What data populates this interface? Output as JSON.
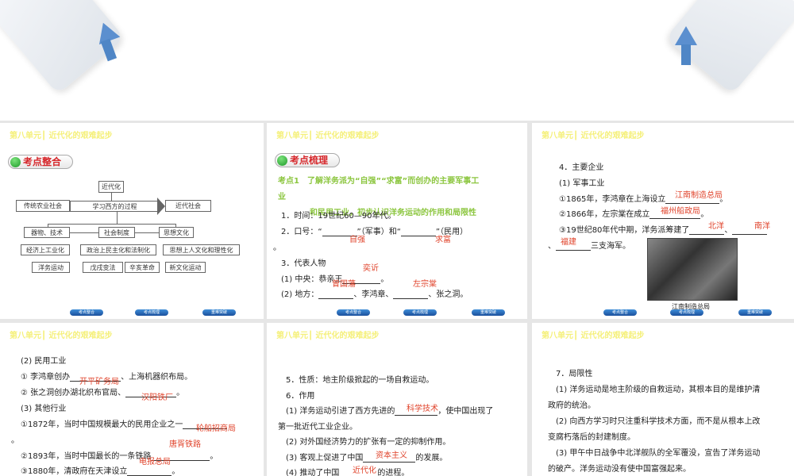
{
  "unit_header": "第八单元┃ 近代化的艰难起步",
  "nav": [
    "考点整合",
    "考点梳理",
    "重难突破"
  ],
  "slide1": {
    "badge": "考点整合",
    "diagram": {
      "top": "近代化",
      "left": "传统农业社会",
      "arrow": "学习西方的过程",
      "right": "近代社会",
      "c1": "器物、技术",
      "c2": "社会制度",
      "c3": "思想文化",
      "d1": "经济上工业化",
      "d2": "政治上民主化和法制化",
      "d3": "思想上人文化和理性化",
      "e1": "洋务运动",
      "e2": "戊戌变法",
      "e3": "辛亥革命",
      "e4": "新文化运动"
    }
  },
  "slide2": {
    "badge": "考点梳理",
    "point": "考点1　了解洋务派为“自强”“求富”而创办的主要军事工",
    "point2": "业",
    "overlay": "和民用工业，初步认识洋务运动的作用和局限性",
    "l1": "1．时间：19世纪60—90年代。",
    "l2a": "2．口号：“",
    "l2b": "”（军事）和“",
    "l2c": "”（民用）",
    "l3": "。",
    "l4": "3．代表人物",
    "l5a": "(1) 中央：恭亲王",
    "l5b": "。",
    "l6a": "(2) 地方：",
    "l6b": "、李鸿章、",
    "l6c": "、张之洞。",
    "answers": {
      "a1": "自强",
      "a2": "求富",
      "a3": "奕䜣",
      "a4": "曾国藩",
      "a5": "左宗棠"
    }
  },
  "slide3": {
    "l1": "4．主要企业",
    "l2": "(1) 军事工业",
    "l3a": "①1865年，李鸿章在上海设立",
    "l3b": "。",
    "l4a": "②1866年，左宗棠在成立",
    "l4b": "。",
    "l5a": "③19世纪80年代中期，洋务派筹建了",
    "l5b": "、",
    "l6a": "、",
    "l6b": "三支海军。",
    "caption": "江南制造总局",
    "answers": {
      "a1": "江南制造总局",
      "a2": "福州船政局",
      "a3": "北洋",
      "a4": "南洋",
      "a5": "福建"
    }
  },
  "slide4": {
    "l1": "(2) 民用工业",
    "l2a": "① 李鸿章创办",
    "l2b": "、上海机器织布局。",
    "l3a": "② 张之洞创办湖北织布官局、",
    "l3b": "。",
    "l4": "(3) 其他行业",
    "l5": "①1872年，当时中国规模最大的民用企业之一",
    "l6": "。",
    "l7a": "②1893年，当时中国最长的一条铁路",
    "l7b": "。",
    "l8a": "③1880年，清政府在天津设立",
    "l8b": "。",
    "answers": {
      "a1": "开平矿务局",
      "a2": "汉阳铁厂",
      "a3": "轮船招商局",
      "a4": "唐胥铁路",
      "a5": "电报总局"
    }
  },
  "slide5": {
    "l1": "5．性质：地主阶级掀起的一场自救运动。",
    "l2": "6．作用",
    "l3a": "(1) 洋务运动引进了西方先进的",
    "l3b": "，使中国出现了",
    "l4": "第一批近代工业企业。",
    "l5": "(2) 对外国经济势力的扩张有一定的抑制作用。",
    "l6a": "(3) 客观上促进了中国",
    "l6b": "的发展。",
    "l7a": "(4) 推动了中国",
    "l7b": "的进程。",
    "answers": {
      "a1": "科学技术",
      "a2": "资本主义",
      "a3": "近代化"
    }
  },
  "slide6": {
    "l1": "7．局限性",
    "l2": "(1) 洋务运动是地主阶级的自救运动，其根本目的是维护清",
    "l3": "政府的统治。",
    "l4": "(2) 向西方学习时只注重科学技术方面，而不是从根本上改",
    "l5": "变腐朽落后的封建制度。",
    "l6": "(3) 甲午中日战争中北洋舰队的全军覆没，宣告了洋务运动",
    "l7": "的破产。洋务运动没有使中国富强起来。"
  }
}
